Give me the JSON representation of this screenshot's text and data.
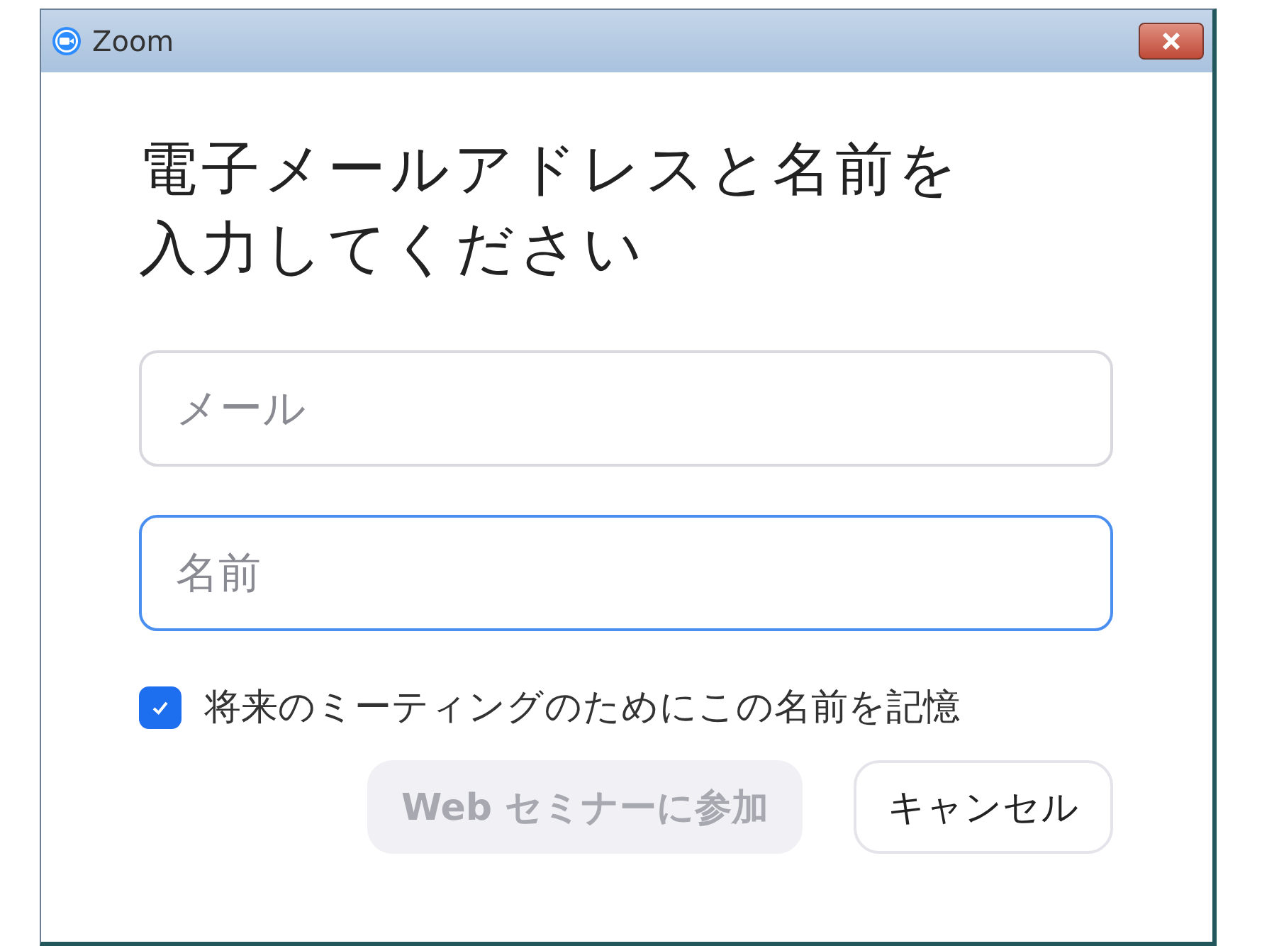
{
  "window": {
    "title": "Zoom"
  },
  "heading": "電子メールアドレスと名前を入力してください",
  "fields": [
    {
      "placeholder": "メール",
      "focused": false
    },
    {
      "placeholder": "名前",
      "focused": true
    }
  ],
  "remember": {
    "label": "将来のミーティングのためにこの名前を記憶",
    "checked": true
  },
  "buttons": [
    {
      "label": "Web セミナーに参加",
      "disabled": true
    },
    {
      "label": "キャンセル",
      "disabled": false
    }
  ]
}
